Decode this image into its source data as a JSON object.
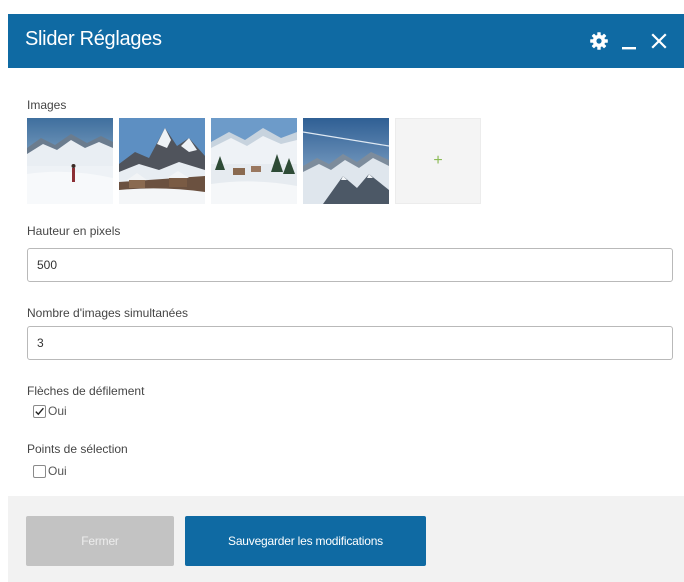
{
  "dialog": {
    "title": "Slider Réglages",
    "controls": [
      "gear-icon",
      "minimize-icon",
      "close-icon"
    ]
  },
  "images": {
    "label": "Images",
    "thumbnails": [
      {
        "subject": "snowy valley with skier"
      },
      {
        "subject": "mountain peak with chalets"
      },
      {
        "subject": "alpine village in snow"
      },
      {
        "subject": "snowy mountain range"
      }
    ],
    "add_label": "+"
  },
  "height": {
    "label": "Hauteur en pixels",
    "value": "500"
  },
  "count": {
    "label": "Nombre d'images simultanées",
    "value": "3"
  },
  "arrows": {
    "label": "Flèches de défilement",
    "option": "Oui",
    "checked": true
  },
  "dots": {
    "label": "Points de sélection",
    "option": "Oui",
    "checked": false
  },
  "footer": {
    "close_label": "Fermer",
    "save_label": "Sauvegarder les modifications"
  },
  "colors": {
    "primary": "#0f6aa3",
    "disabled_button": "#c3c3c3",
    "add_plus": "#8bbb55"
  }
}
